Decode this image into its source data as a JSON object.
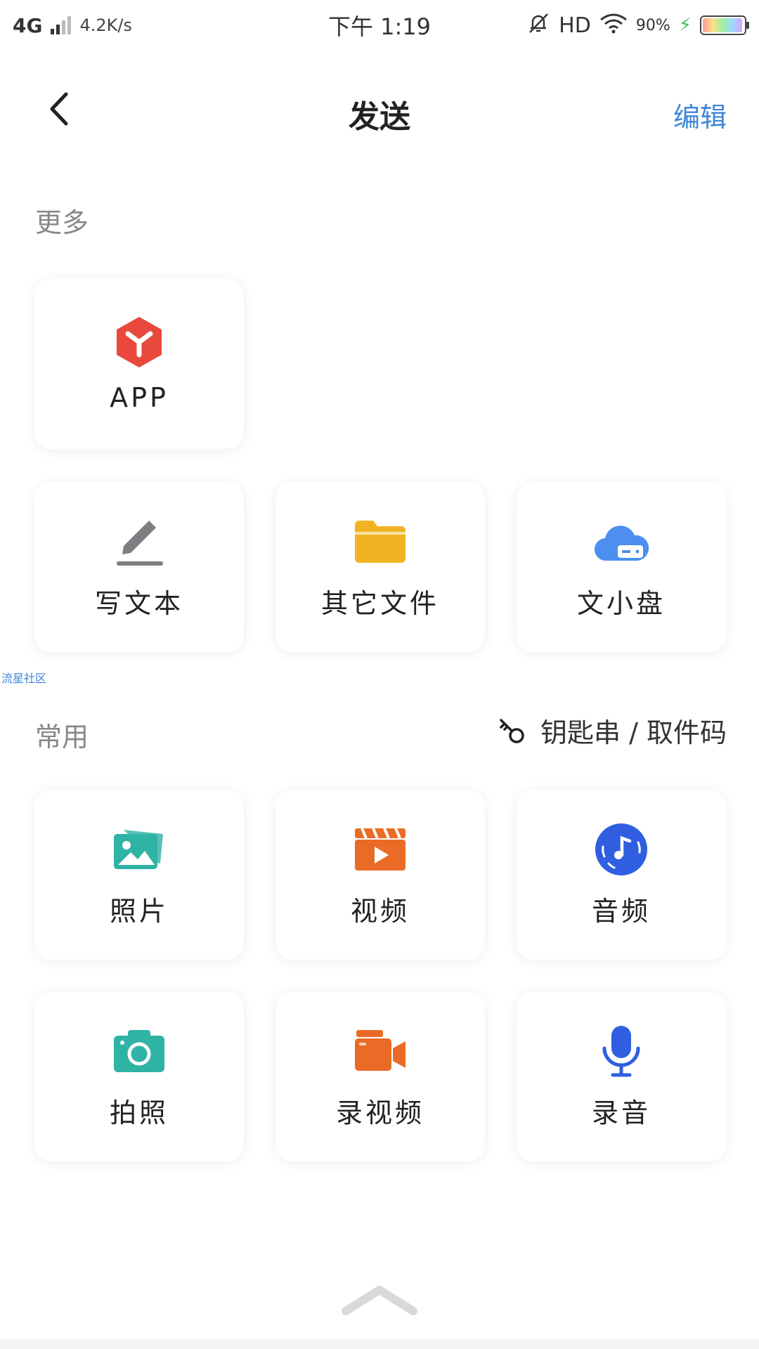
{
  "status_bar": {
    "network": "4G",
    "speed": "4.2K/s",
    "time": "下午 1:19",
    "hd": "HD",
    "battery_pct": "90%"
  },
  "header": {
    "title": "发送",
    "edit_label": "编辑"
  },
  "sections": {
    "more_label": "更多",
    "common_label": "常用",
    "key_link_label": "钥匙串 / 取件码"
  },
  "watermark": "流星社区",
  "more_items": [
    {
      "label": "APP",
      "icon": "app-cube-icon"
    },
    {
      "label": "写文本",
      "icon": "pencil-icon"
    },
    {
      "label": "其它文件",
      "icon": "folder-icon"
    },
    {
      "label": "文小盘",
      "icon": "cloud-drive-icon"
    }
  ],
  "common_items": [
    {
      "label": "照片",
      "icon": "photo-icon"
    },
    {
      "label": "视频",
      "icon": "video-clapper-icon"
    },
    {
      "label": "音频",
      "icon": "music-disc-icon"
    },
    {
      "label": "拍照",
      "icon": "camera-icon"
    },
    {
      "label": "录视频",
      "icon": "video-camera-icon"
    },
    {
      "label": "录音",
      "icon": "microphone-icon"
    }
  ],
  "colors": {
    "accent_blue": "#3d86d6",
    "app_red": "#e8493c",
    "pencil_gray": "#7d7f82",
    "folder_yellow": "#f0b323",
    "cloud_blue": "#4d8ff0",
    "photo_teal": "#2fb3a4",
    "video_orange": "#ea6b25",
    "audio_blue": "#2f5fe0"
  }
}
